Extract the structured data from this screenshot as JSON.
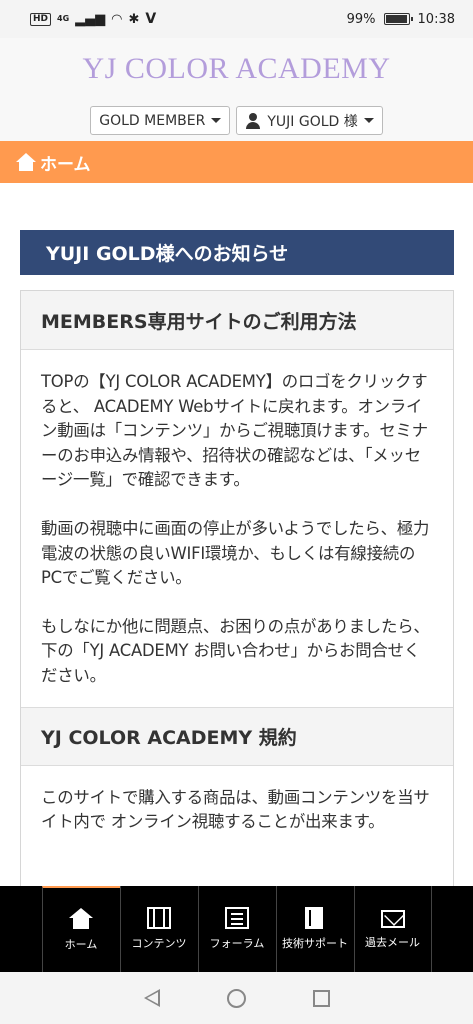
{
  "status_bar": {
    "hd": "HD",
    "network": "4G",
    "carrier_glyph": "V",
    "battery": "99%",
    "battery_level": 0.99,
    "time": "10:38"
  },
  "header": {
    "logo": "YJ COLOR ACADEMY",
    "member_dropdown": "GOLD MEMBER",
    "user_dropdown": "YUJI GOLD 様"
  },
  "breadcrumb": {
    "home": "ホーム"
  },
  "notice": {
    "title": "YUJI GOLD様へのお知らせ"
  },
  "panel": {
    "section1_title": "MEMBERS専用サイトのご利用方法",
    "section1_paragraphs": [
      "TOPの【YJ COLOR ACADEMY】のロゴをクリックすると、 ACADEMY Webサイトに戻れます。オンライン動画は「コンテンツ」からご視聴頂けます。セミナーのお申込み情報や、招待状の確認などは、「メッセージ一覧」で確認できます。",
      "動画の視聴中に画面の停止が多いようでしたら、極力電波の状態の良いWIFI環境か、もしくは有線接続のPCでご覧ください。",
      "もしなにか他に問題点、お困りの点がありましたら、下の「YJ ACADEMY お問い合わせ」からお問合せください。"
    ],
    "section2_title": "YJ COLOR ACADEMY 規約",
    "section2_paragraph": "このサイトで購入する商品は、動画コンテンツを当サイト内で オンライン視聴することが出来ます。"
  },
  "bottom_nav": [
    {
      "label": "ホーム",
      "icon": "home-icon"
    },
    {
      "label": "コンテンツ",
      "icon": "film-icon"
    },
    {
      "label": "フォーラム",
      "icon": "list-icon"
    },
    {
      "label": "技術サポート",
      "icon": "book-icon"
    },
    {
      "label": "過去メール",
      "icon": "mail-icon"
    }
  ],
  "colors": {
    "accent_orange": "#ff9a4f",
    "notice_navy": "#324a77",
    "logo_lavender": "#b39ddb"
  }
}
